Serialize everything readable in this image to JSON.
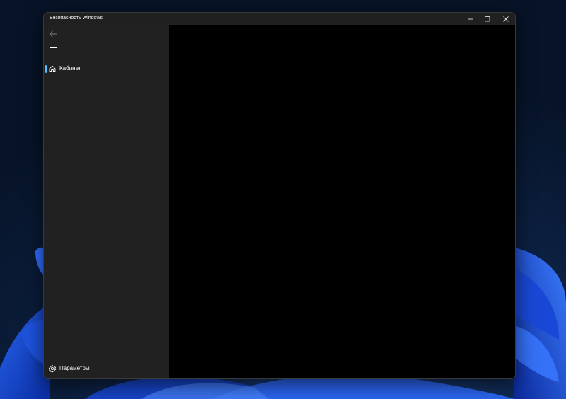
{
  "window": {
    "title": "Безопасность Windows"
  },
  "sidebar": {
    "items": [
      {
        "label": "Кабинет",
        "icon": "home-icon",
        "selected": true
      }
    ],
    "footer": {
      "label": "Параметры",
      "icon": "gear-icon"
    }
  },
  "colors": {
    "accent": "#4cc2ff",
    "sidebar_bg": "#212121",
    "content_bg": "#000000",
    "titlebar_bg": "#202020"
  }
}
